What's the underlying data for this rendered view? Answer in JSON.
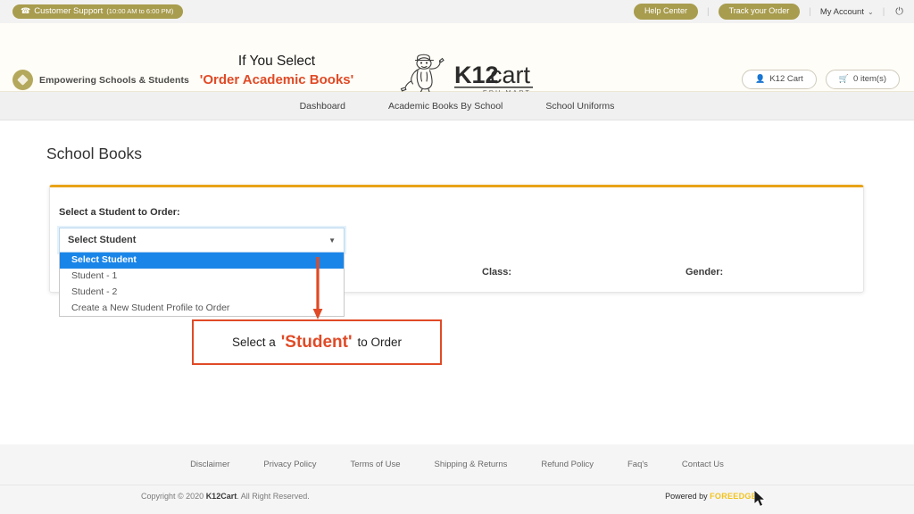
{
  "topbar": {
    "support_icon": "phone-icon",
    "support_label": "Customer Support",
    "support_hours": "(10:00 AM to 6:00 PM)",
    "help_center": "Help Center",
    "track_order": "Track your Order",
    "my_account": "My Account",
    "chevron": "⌄",
    "power_icon": "⏻",
    "separator": "|",
    "badge_color": "#a89c4e"
  },
  "header": {
    "brand_tagline": "Empowering Schools & Students",
    "brand_mark_icon": "diamond-badge-icon",
    "annotation_line1": "If You Select",
    "annotation_line2": "'Order Academic Books'",
    "annotation_accent": "#e04a26",
    "logo_text": "K12cart",
    "logo_subtext": "EDU MART",
    "logo_mascot_icon": "mascot-icon",
    "cart_account_icon": "user-icon",
    "cart_account_label": "K12 Cart",
    "cart_bag_icon": "cart-icon",
    "cart_items_label": "0 item(s)"
  },
  "nav": {
    "items": [
      {
        "label": "Dashboard"
      },
      {
        "label": "Academic Books By School"
      },
      {
        "label": "School Uniforms"
      }
    ]
  },
  "main": {
    "page_title": "School Books",
    "card_accent_color": "#e8a317",
    "select_label": "Select a Student to Order:",
    "select_value": "Select Student",
    "select_caret": "▼",
    "dropdown_options": [
      {
        "label": "Select Student",
        "selected": true
      },
      {
        "label": "Student - 1",
        "selected": false
      },
      {
        "label": "Student - 2",
        "selected": false
      },
      {
        "label": "Create a New Student Profile to Order",
        "selected": false
      }
    ],
    "class_label": "Class:",
    "gender_label": "Gender:"
  },
  "callout": {
    "arrow_color": "#e04a26",
    "text_before": "Select a",
    "text_highlight": "'Student'",
    "text_after": "to Order",
    "border_color": "#e04a26"
  },
  "footer": {
    "links": [
      {
        "label": "Disclaimer"
      },
      {
        "label": "Privacy Policy"
      },
      {
        "label": "Terms of Use"
      },
      {
        "label": "Shipping & Returns"
      },
      {
        "label": "Refund Policy"
      },
      {
        "label": "Faq's"
      },
      {
        "label": "Contact Us"
      }
    ],
    "copyright_prefix": "Copyright © 2020 ",
    "copyright_brand": "K12Cart",
    "copyright_suffix": ". All Right Reserved.",
    "powered_prefix": "Powered by ",
    "powered_brand": "FOREEDGE",
    "powered_brand_color": "#f2c31e",
    "cursor_icon": "mouse-pointer-icon"
  }
}
